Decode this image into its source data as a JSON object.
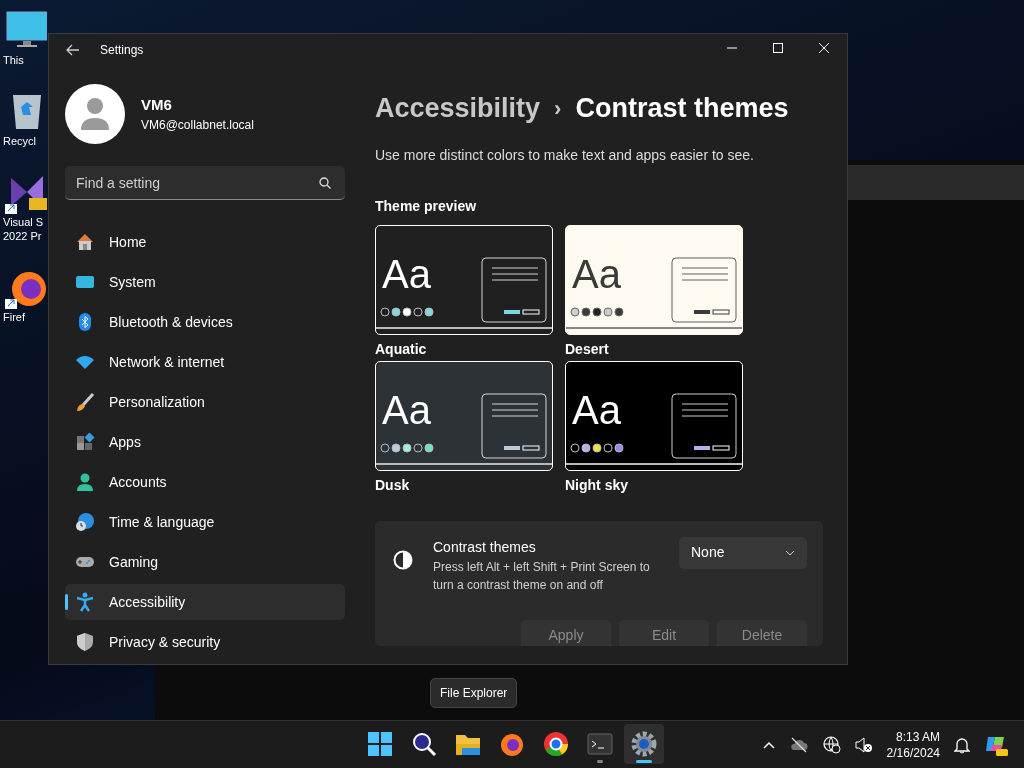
{
  "desktop_icons": [
    {
      "kind": "monitor",
      "lines": [
        "This"
      ]
    },
    {
      "kind": "recycle",
      "lines": [
        "Recycl"
      ]
    },
    {
      "kind": "studio",
      "lines": [
        "Visual S",
        "2022 Pr"
      ]
    },
    {
      "kind": "firefox",
      "lines": [
        "Firef"
      ]
    }
  ],
  "window": {
    "title": "Settings"
  },
  "user": {
    "name": "VM6",
    "email": "VM6@collabnet.local"
  },
  "search": {
    "placeholder": "Find a setting"
  },
  "nav": [
    {
      "kind": "home",
      "label": "Home",
      "selected": false
    },
    {
      "kind": "system",
      "label": "System",
      "selected": false
    },
    {
      "kind": "bluetooth",
      "label": "Bluetooth & devices",
      "selected": false
    },
    {
      "kind": "network",
      "label": "Network & internet",
      "selected": false
    },
    {
      "kind": "brush",
      "label": "Personalization",
      "selected": false
    },
    {
      "kind": "apps",
      "label": "Apps",
      "selected": false
    },
    {
      "kind": "accounts",
      "label": "Accounts",
      "selected": false
    },
    {
      "kind": "time",
      "label": "Time & language",
      "selected": false
    },
    {
      "kind": "gaming",
      "label": "Gaming",
      "selected": false
    },
    {
      "kind": "accessibility",
      "label": "Accessibility",
      "selected": true
    },
    {
      "kind": "privacy",
      "label": "Privacy & security",
      "selected": false
    }
  ],
  "breadcrumb": {
    "parent": "Accessibility",
    "separator": "›",
    "current": "Contrast themes"
  },
  "description": "Use more distinct colors to make text and apps easier to see.",
  "preview_heading": "Theme preview",
  "themes": [
    {
      "name": "Aquatic",
      "color": "#202020",
      "sample": "Aa"
    },
    {
      "name": "Desert",
      "color": "#fffaef",
      "sample": "Aa"
    },
    {
      "name": "Dusk",
      "color": "#2d3236",
      "sample": "Aa"
    },
    {
      "name": "Night sky",
      "color": "#000000",
      "sample": "Aa"
    }
  ],
  "setting": {
    "title": "Contrast themes",
    "description": "Press left Alt + left Shift + Print Screen to turn a contrast theme on and off",
    "dropdown": "None"
  },
  "actions": [
    {
      "label": "Apply",
      "disabled": true
    },
    {
      "label": "Edit",
      "disabled": true
    },
    {
      "label": "Delete",
      "disabled": true
    }
  ],
  "tooltip": "File Explorer",
  "taskbar": [
    {
      "kind": "start",
      "selected": false,
      "running": false
    },
    {
      "kind": "search",
      "selected": false,
      "running": false
    },
    {
      "kind": "folder",
      "selected": false,
      "running": false
    },
    {
      "kind": "firefox",
      "selected": false,
      "running": false
    },
    {
      "kind": "chrome",
      "selected": false,
      "running": false
    },
    {
      "kind": "terminal",
      "selected": false,
      "running": true
    },
    {
      "kind": "gear",
      "selected": true,
      "running": true
    }
  ],
  "clock": {
    "time": "8:13 AM",
    "date": "2/16/2024"
  }
}
